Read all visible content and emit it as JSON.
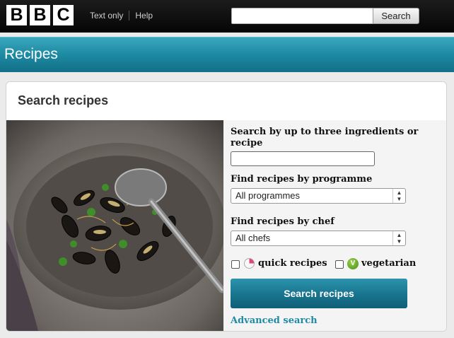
{
  "header": {
    "logo_letters": [
      "B",
      "B",
      "C"
    ],
    "links": [
      "Text only",
      "Help"
    ],
    "search_placeholder": "",
    "search_button": "Search"
  },
  "band": {
    "title": "Recipes"
  },
  "card": {
    "title": "Search recipes",
    "photo_icon": "mussels-dish-photo",
    "ingredients_label": "Search by up to three ingredients or recipe",
    "ingredients_value": "",
    "programme_label": "Find recipes by programme",
    "programme_selected": "All programmes",
    "chef_label": "Find recipes by chef",
    "chef_selected": "All chefs",
    "quick_label": "quick recipes",
    "vegetarian_label": "vegetarian",
    "veg_glyph": "V",
    "submit_label": "Search recipes",
    "advanced_link": "Advanced search"
  },
  "colors": {
    "band": "#1d8aa3",
    "button": "#1a7690",
    "link": "#1f8aa6",
    "quick_icon": "#e0457b",
    "veg_icon": "#6aa82a"
  }
}
